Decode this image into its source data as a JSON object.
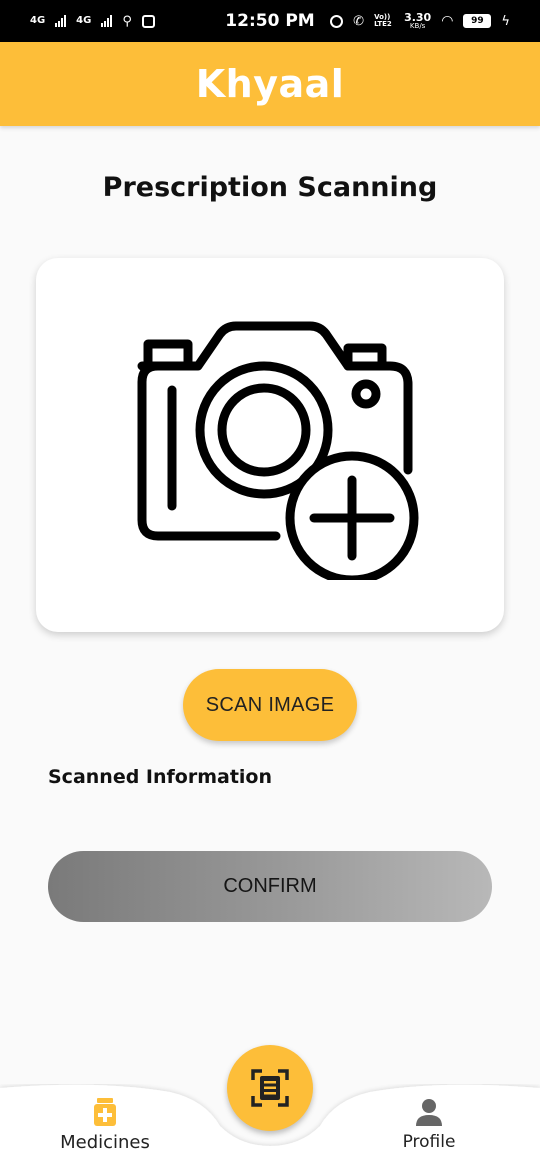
{
  "status_bar": {
    "network_left": "4G",
    "network_right": "4G",
    "time": "12:50 PM",
    "volte": "Vo)) LTE2",
    "speed_value": "3.30",
    "speed_unit": "KB/s",
    "battery": "99"
  },
  "app": {
    "title": "Khyaal",
    "accent_color": "#fdbe39"
  },
  "main": {
    "page_title": "Prescription Scanning",
    "image_placeholder_icon": "camera-add-icon",
    "scan_button_label": "SCAN IMAGE",
    "section_label": "Scanned Information",
    "confirm_button_label": "CONFIRM"
  },
  "bottom_nav": {
    "items": [
      {
        "label": "Medicines",
        "icon": "medicine-bottle-icon",
        "active": true
      },
      {
        "label": "Profile",
        "icon": "person-icon",
        "active": false
      }
    ],
    "fab_icon": "scan-document-icon"
  }
}
